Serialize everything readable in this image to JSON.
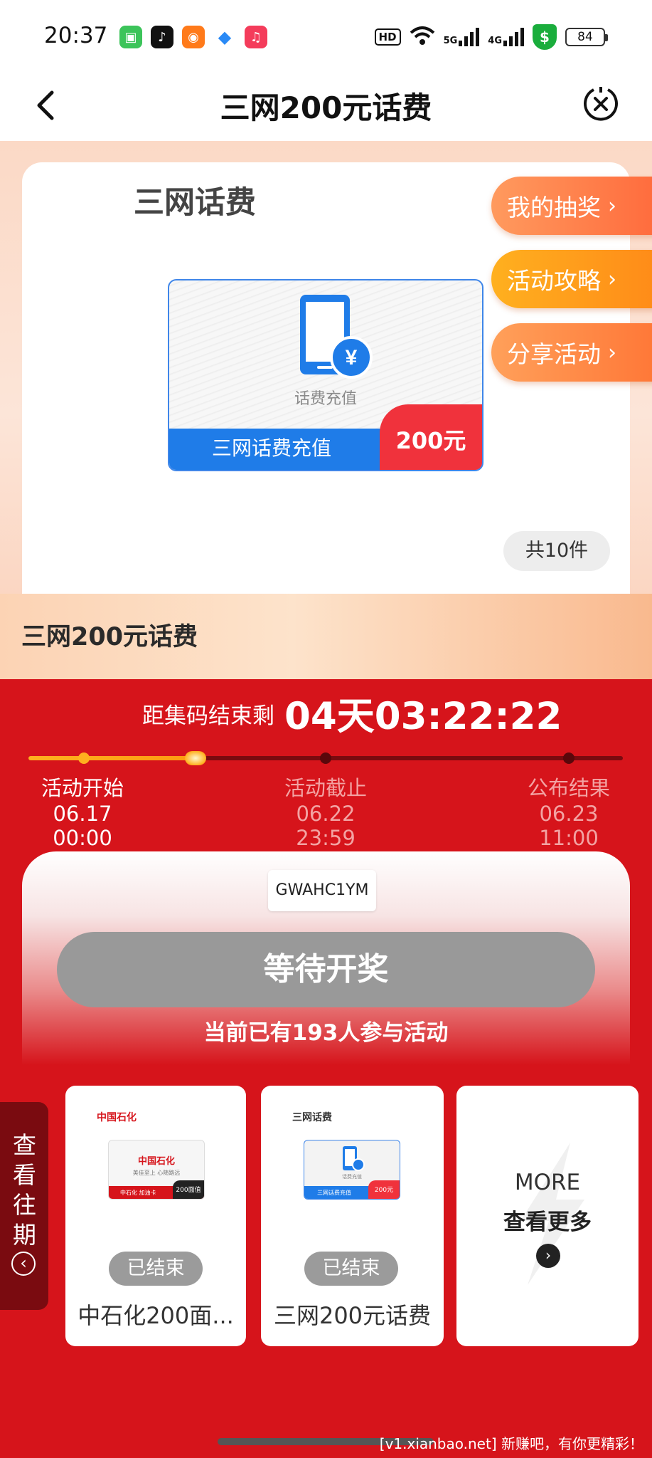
{
  "status_bar": {
    "time": "20:37",
    "hd_label": "HD",
    "net1": "5G",
    "net2": "4G",
    "battery": "84"
  },
  "header": {
    "title": "三网200元话费"
  },
  "prize": {
    "card_title": "三网话费",
    "card_image_label": "话费充值",
    "card_image_bottom": "三网话费充值",
    "card_image_price": "200元",
    "count": "共10件"
  },
  "side_buttons": [
    {
      "label": "我的抽奖"
    },
    {
      "label": "活动攻略"
    },
    {
      "label": "分享活动"
    }
  ],
  "activity_name": "三网200元话费",
  "countdown": {
    "label": "距集码结束剩",
    "value": "04天03:22:22"
  },
  "timeline": [
    {
      "title": "活动开始",
      "time": "06.17 00:00"
    },
    {
      "title": "活动截止",
      "time": "06.22 23:59"
    },
    {
      "title": "公布结果",
      "time": "06.23 11:00"
    }
  ],
  "code": "GWAHC1YM",
  "wait_button": "等待开奖",
  "participants": "当前已有193人参与活动",
  "history_tab": {
    "chars": [
      "查",
      "看",
      "往",
      "期"
    ]
  },
  "history_cards": [
    {
      "brand": "中国石化",
      "thumb_title": "中国石化",
      "thumb_sub": "美佳至上 心随路远",
      "thumb_bottom": "中石化 加油卡",
      "thumb_tag": "200面值",
      "status": "已结束",
      "name": "中石化200面..."
    },
    {
      "brand": "三网话费",
      "thumb_title": "话费充值",
      "thumb_bottom": "三网话费充值",
      "thumb_tag": "200元",
      "status": "已结束",
      "name": "三网200元话费"
    }
  ],
  "more_card": {
    "en": "MORE",
    "cn": "查看更多"
  },
  "watermark": "[v1.xianbao.net] 新赚吧，有你更精彩！",
  "colors": {
    "primary_red": "#d6141b",
    "accent_orange": "#ff8a18",
    "blue": "#1f7ce8"
  }
}
